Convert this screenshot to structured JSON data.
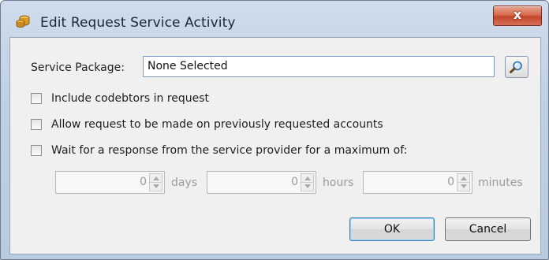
{
  "window": {
    "title": "Edit Request Service Activity",
    "close_symbol": "x",
    "app_icon": "coins-icon"
  },
  "form": {
    "service_package_label": "Service Package:",
    "service_package_value": "None Selected",
    "search_icon": "magnifier-icon",
    "options": [
      {
        "label": "Include codebtors in request",
        "checked": false
      },
      {
        "label": "Allow request to be made on previously requested accounts",
        "checked": false
      },
      {
        "label": "Wait for a response from the service provider for a maximum of:",
        "checked": false
      }
    ],
    "wait": {
      "days_value": "0",
      "days_label": "days",
      "hours_value": "0",
      "hours_label": "hours",
      "minutes_value": "0",
      "minutes_label": "minutes",
      "enabled": false
    }
  },
  "buttons": {
    "ok_label": "OK",
    "cancel_label": "Cancel"
  },
  "colors": {
    "title_bar": "#bfd0e4",
    "close_button": "#c2452a",
    "dialog_bg": "#f0f0f0",
    "default_button_border": "#3c7fb1"
  }
}
